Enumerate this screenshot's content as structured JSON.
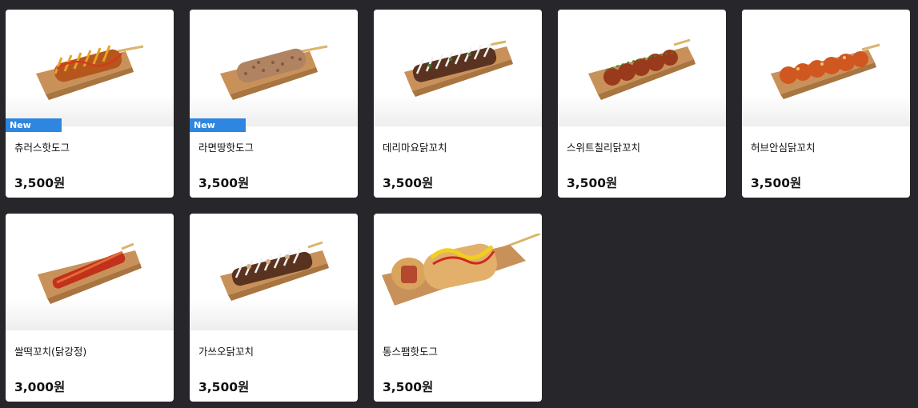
{
  "products": [
    {
      "name": "츄러스핫도그",
      "price": "3,500원",
      "badge": "New",
      "image": "churros-hotdog-image"
    },
    {
      "name": "라면땅핫도그",
      "price": "3,500원",
      "badge": "New",
      "image": "ramen-crumb-hotdog-image"
    },
    {
      "name": "데리마요닭꼬치",
      "price": "3,500원",
      "badge": "",
      "image": "teriyaki-mayo-skewer-image"
    },
    {
      "name": "스위트칠리닭꼬치",
      "price": "3,500원",
      "badge": "",
      "image": "sweet-chili-skewer-image"
    },
    {
      "name": "허브안심닭꼬치",
      "price": "3,500원",
      "badge": "",
      "image": "herb-tenderloin-skewer-image"
    },
    {
      "name": "쌀떡꼬치(닭강정)",
      "price": "3,000원",
      "badge": "",
      "image": "rice-cake-skewer-image"
    },
    {
      "name": "가쓰오닭꼬치",
      "price": "3,500원",
      "badge": "",
      "image": "katsuo-skewer-image"
    },
    {
      "name": "통스팸핫도그",
      "price": "3,500원",
      "badge": "",
      "image": "spam-hotdog-image"
    }
  ],
  "colors": {
    "background": "#26262b",
    "card": "#ffffff",
    "badge": "#2e86e0",
    "tray": "#c9915a"
  }
}
